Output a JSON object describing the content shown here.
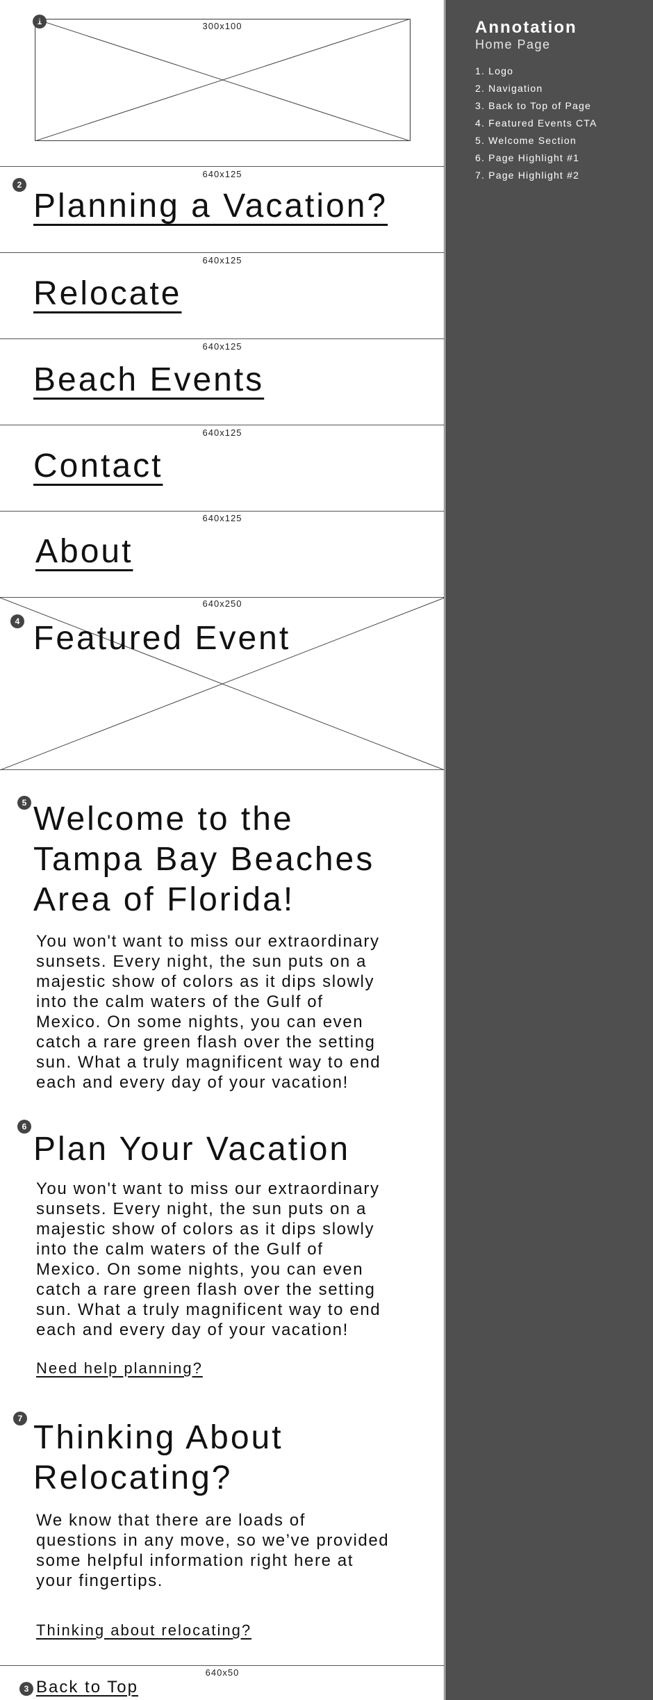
{
  "logo": {
    "size_label": "300x100",
    "badge": "1"
  },
  "nav": {
    "badge": "2",
    "items": [
      {
        "size_label": "640x125",
        "label": "Planning a Vacation?"
      },
      {
        "size_label": "640x125",
        "label": "Relocate"
      },
      {
        "size_label": "640x125",
        "label": "Beach Events"
      },
      {
        "size_label": "640x125",
        "label": "Contact"
      },
      {
        "size_label": "640x125",
        "label": "About"
      }
    ]
  },
  "featured": {
    "badge": "4",
    "size_label": "640x250",
    "title": "Featured Event"
  },
  "welcome": {
    "badge": "5",
    "title_lines": [
      "Welcome to the",
      "Tampa Bay Beaches",
      "Area of Florida!"
    ],
    "body_lines": [
      "You won't want to miss our extraordinary",
      "sunsets. Every night, the sun puts on a",
      "majestic show of colors as it dips slowly",
      "into the calm waters of the Gulf of",
      "Mexico. On some nights, you can even",
      "catch a rare green flash over the setting",
      "sun. What a truly magnificent way to end",
      "each and every day of your vacation!"
    ]
  },
  "highlight1": {
    "badge": "6",
    "title": "Plan Your Vacation",
    "body_lines": [
      "You won't want to miss our extraordinary",
      "sunsets. Every night, the sun puts on a",
      "majestic show of colors as it dips slowly",
      "into the calm waters of the Gulf of",
      "Mexico. On some nights, you can even",
      "catch a rare green flash over the setting",
      "sun. What a truly magnificent way to end",
      "each and every day of your vacation!"
    ],
    "link": "Need help planning?"
  },
  "highlight2": {
    "badge": "7",
    "title_lines": [
      "Thinking About",
      "Relocating?"
    ],
    "body_lines": [
      "We know that there are loads of",
      "questions in any move, so we’ve provided",
      "some helpful information right here at",
      "your fingertips."
    ],
    "link": "Thinking about relocating?"
  },
  "back_to_top": {
    "badge": "3",
    "size_label": "640x50",
    "label": "Back to Top"
  },
  "annotation": {
    "title": "Annotation",
    "subtitle": "Home Page",
    "items": [
      "1. Logo",
      "2. Navigation",
      "3. Back to Top of Page",
      "4. Featured Events CTA",
      "5. Welcome Section",
      "6. Page Highlight #1",
      "7. Page Highlight #2"
    ]
  }
}
